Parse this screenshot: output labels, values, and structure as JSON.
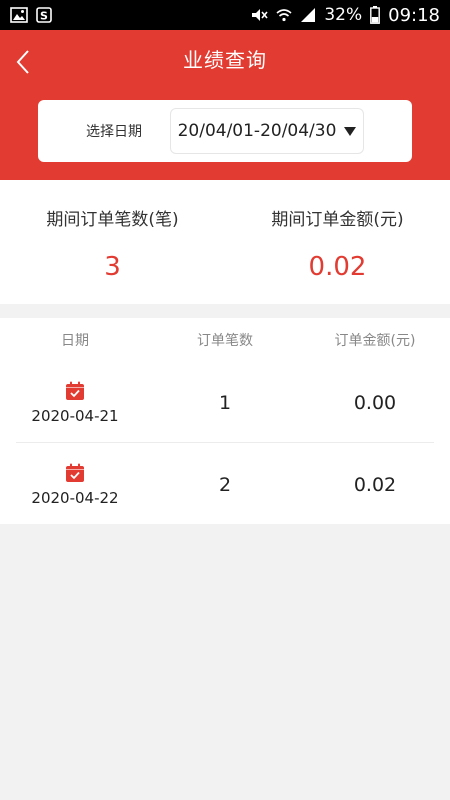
{
  "status_bar": {
    "battery_percent": "32%",
    "time": "09:18",
    "icons": [
      "gallery-icon",
      "s-app-icon",
      "mute-icon",
      "wifi-icon",
      "signal-icon",
      "battery-icon"
    ]
  },
  "header": {
    "title": "业绩查询",
    "back_icon": "chevron-left-icon",
    "date_label": "选择日期",
    "date_range": "20/04/01-20/04/30",
    "dropdown_icon": "triangle-down-icon"
  },
  "summary": {
    "order_count_label": "期间订单笔数(笔)",
    "order_count_value": "3",
    "order_amount_label": "期间订单金额(元)",
    "order_amount_value": "0.02"
  },
  "table": {
    "columns": [
      "日期",
      "订单笔数",
      "订单金额(元)"
    ],
    "rows": [
      {
        "date": "2020-04-21",
        "count": "1",
        "amount": "0.00"
      },
      {
        "date": "2020-04-22",
        "count": "2",
        "amount": "0.02"
      }
    ]
  },
  "colors": {
    "accent": "#e23b32",
    "background": "#f2f2f2"
  }
}
